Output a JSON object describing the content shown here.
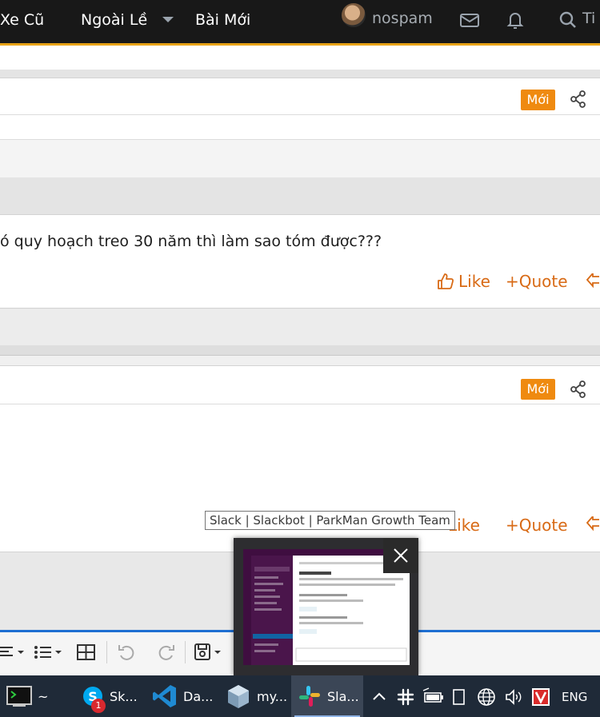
{
  "nav": {
    "links": [
      "Xe Cũ",
      "Ngoài Lề",
      "Bài Mới"
    ],
    "username": "nospam",
    "search_fragment": "Ti"
  },
  "posts": [
    {
      "badge": "Mới",
      "text": "ó quy hoạch treo 30 năm thì làm sao tóm được???",
      "actions": [
        "Like",
        "+Quote"
      ]
    },
    {
      "badge": "Mới",
      "text": "",
      "actions": [
        "Like",
        "+Quote"
      ]
    }
  ],
  "tooltip": "Slack | Slackbot | ParkMan Growth Team",
  "taskbar": {
    "items": [
      {
        "label": "~",
        "icon": "terminal-icon"
      },
      {
        "label": "Sk...",
        "icon": "skype-icon",
        "badge": "1"
      },
      {
        "label": "Da...",
        "icon": "vscode-icon"
      },
      {
        "label": "my...",
        "icon": "cube-app-icon"
      },
      {
        "label": "Sla...",
        "icon": "slack-icon",
        "active": true
      }
    ],
    "tray_language": "ENG"
  },
  "colors": {
    "accent_orange": "#ef8a10",
    "action_orange": "#d86a15",
    "nav_bg": "#181818",
    "taskbar_bg": "#1f2a38"
  }
}
